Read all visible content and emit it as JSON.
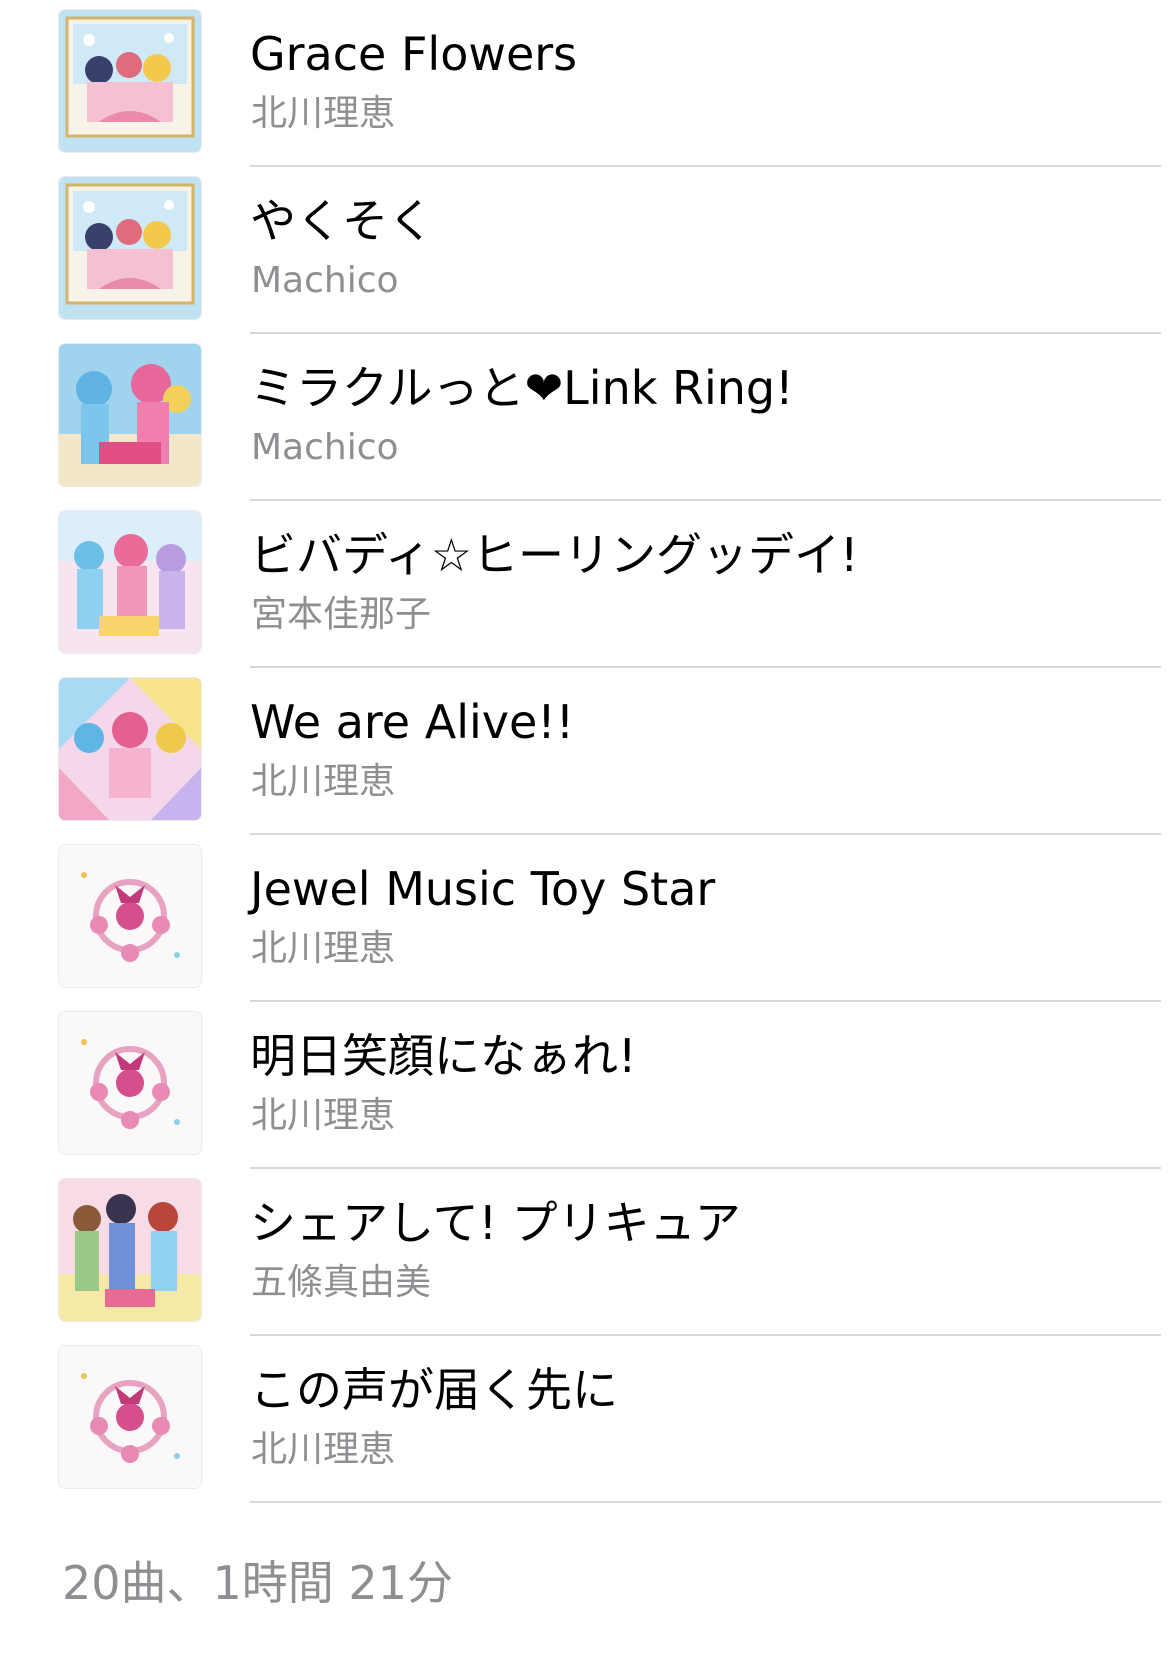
{
  "tracks": [
    {
      "title": "Grace Flowers",
      "artist": "北川理恵",
      "artwork": "artwork-sky"
    },
    {
      "title": "やくそく",
      "artist": "Machico",
      "artwork": "artwork-sky"
    },
    {
      "title": "ミラクルっと❤Link Ring!",
      "artist": "Machico",
      "artwork": "artwork-blue-pink"
    },
    {
      "title": "ビバディ☆ヒーリングッデイ!",
      "artist": "宮本佳那子",
      "artwork": "artwork-pastel"
    },
    {
      "title": "We are Alive!!",
      "artist": "北川理恵",
      "artwork": "artwork-prism"
    },
    {
      "title": "Jewel Music Toy Star",
      "artist": "北川理恵",
      "artwork": "artwork-white-ribbon"
    },
    {
      "title": "明日笑顔になぁれ!",
      "artist": "北川理恵",
      "artwork": "artwork-white-ribbon"
    },
    {
      "title": "シェアして! プリキュア",
      "artist": "五條真由美",
      "artwork": "artwork-group"
    },
    {
      "title": "この声が届く先に",
      "artist": "北川理恵",
      "artwork": "artwork-white-ribbon"
    }
  ],
  "footer": {
    "summary": "20曲、1時間 21分"
  },
  "colors": {
    "primary_text": "#000000",
    "secondary_text": "#8e8e93",
    "separator": "#d8d8dc"
  }
}
